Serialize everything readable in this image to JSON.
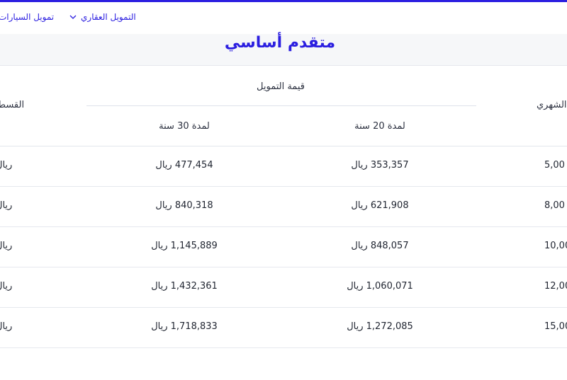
{
  "nav": {
    "realestate_label": "التمويل العقاري",
    "cars_label": "تمويل السيارات",
    "chevron_icon": "chevron-down-icon"
  },
  "page": {
    "title": "متقدم أساسي"
  },
  "table": {
    "funding_header": "قيمة التمويل",
    "monthly_header": "الشهري",
    "installment_header": "القسط",
    "sub_headers": {
      "y20": "لمدة 20 سنة",
      "y30": "لمدة 30 سنة"
    },
    "rows": [
      {
        "monthly": "5,00",
        "y20": "353,357 ريال",
        "y30": "477,454 ريال",
        "installment": "ريال"
      },
      {
        "monthly": "8,00",
        "y20": "621,908 ريال",
        "y30": "840,318 ريال",
        "installment": "ريال"
      },
      {
        "monthly": "10,00",
        "y20": "848,057 ريال",
        "y30": "1,145,889 ريال",
        "installment": "ريال"
      },
      {
        "monthly": "12,00",
        "y20": "1,060,071 ريال",
        "y30": "1,432,361 ريال",
        "installment": "ريال"
      },
      {
        "monthly": "15,00",
        "y20": "1,272,085 ريال",
        "y30": "1,718,833 ريال",
        "installment": "ريال"
      }
    ]
  },
  "colors": {
    "accent": "#2b1ee0",
    "text": "#1f2430",
    "divider": "#e6e8ee"
  }
}
